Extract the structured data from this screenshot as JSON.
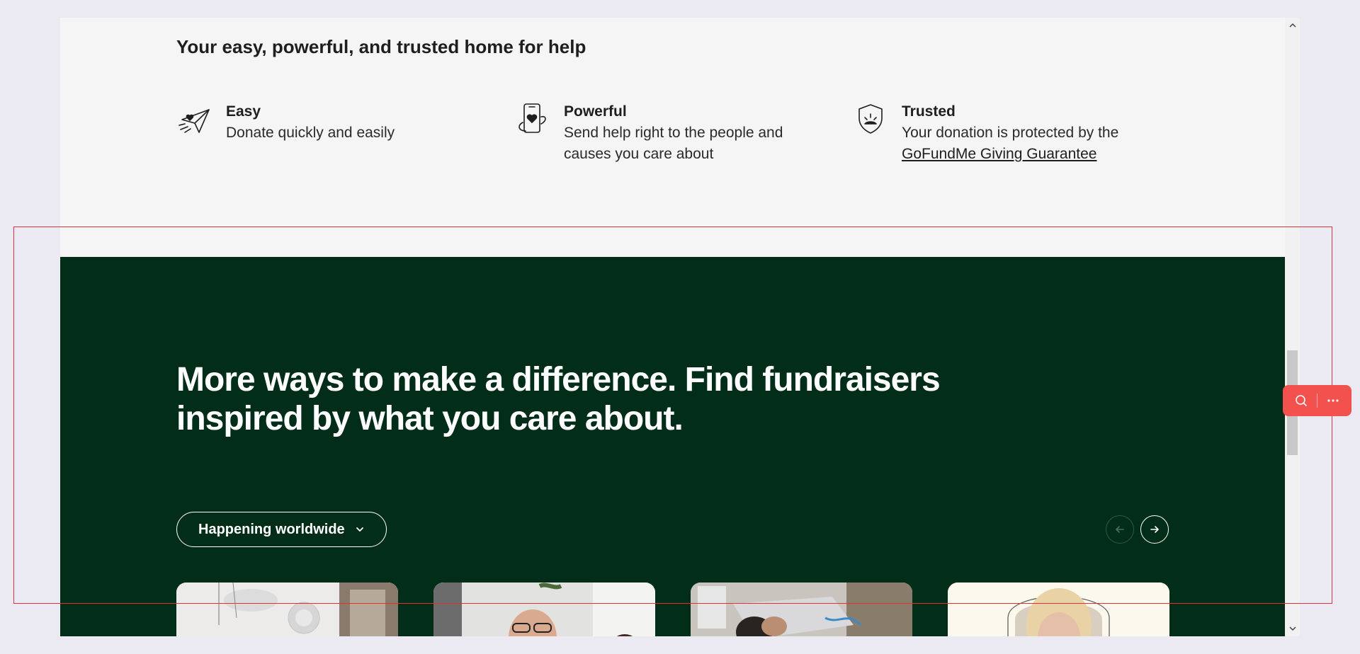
{
  "trust_section": {
    "heading": "Your easy, powerful, and trusted home for help",
    "features": [
      {
        "title": "Easy",
        "line1": "Donate quickly and easily",
        "icon": "paper-plane-heart-icon"
      },
      {
        "title": "Powerful",
        "line1": "Send help right to the people and",
        "line2": "causes you care about",
        "icon": "phone-heart-icon"
      },
      {
        "title": "Trusted",
        "line1": "Your donation is protected by the",
        "link": "GoFundMe Giving Guarantee",
        "icon": "shield-icon"
      }
    ]
  },
  "promo_section": {
    "heading": "More ways to make a difference. Find fundraisers inspired by what you care about.",
    "filter_label": "Happening worldwide",
    "prev_icon": "arrow-left-icon",
    "next_icon": "arrow-right-icon",
    "cards": [
      {
        "name": "card-1",
        "image": "hospital-room-photo"
      },
      {
        "name": "card-2",
        "image": "smiling-man-photo"
      },
      {
        "name": "card-3",
        "image": "patient-in-hospital-bed-photo"
      },
      {
        "name": "card-4",
        "image": "woman-portrait-photo"
      }
    ]
  },
  "colors": {
    "promo_background": "#012d19",
    "page_background": "#f5f5f5",
    "toolbar_accent": "#f3514d",
    "highlight_border": "#e0313a"
  },
  "floating_toolbar": {
    "search_icon": "search-icon",
    "more_icon": "more-options-icon"
  }
}
